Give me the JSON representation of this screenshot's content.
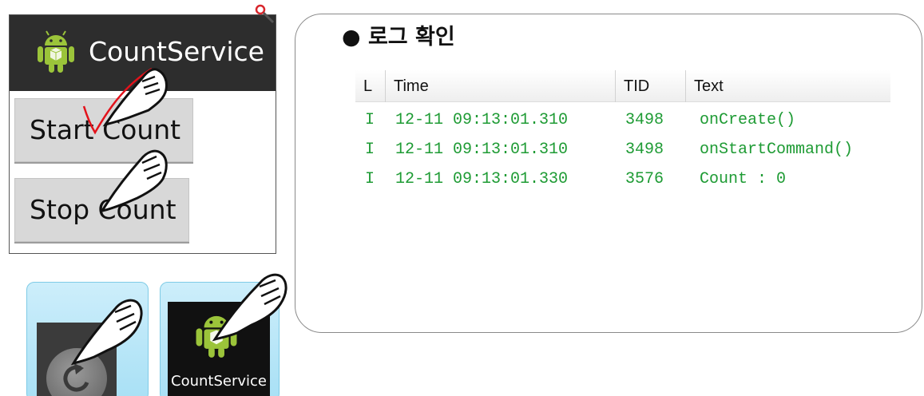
{
  "phone": {
    "app_title": "CountService",
    "start_button": "Start Count",
    "stop_button": "Stop Count"
  },
  "tiles": {
    "app_label": "CountService"
  },
  "log_panel": {
    "heading": "● 로그 확인",
    "columns": [
      "L",
      "Time",
      "TID",
      "Text"
    ],
    "rows": [
      {
        "level": "I",
        "time": "12-11 09:13:01.310",
        "tid": "3498",
        "text": "onCreate()"
      },
      {
        "level": "I",
        "time": "12-11 09:13:01.310",
        "tid": "3498",
        "text": "onStartCommand()"
      },
      {
        "level": "I",
        "time": "12-11 09:13:01.330",
        "tid": "3576",
        "text": "Count : 0"
      }
    ]
  },
  "colors": {
    "action_bar": "#2d2d2d",
    "log_text": "#1e9b34",
    "tile_bg": "#b8e6f7",
    "annotation": "#e3121b"
  },
  "icons": [
    "android-logo-icon",
    "magnifier-icon",
    "back-arrow-icon",
    "pointing-hand-icon"
  ]
}
